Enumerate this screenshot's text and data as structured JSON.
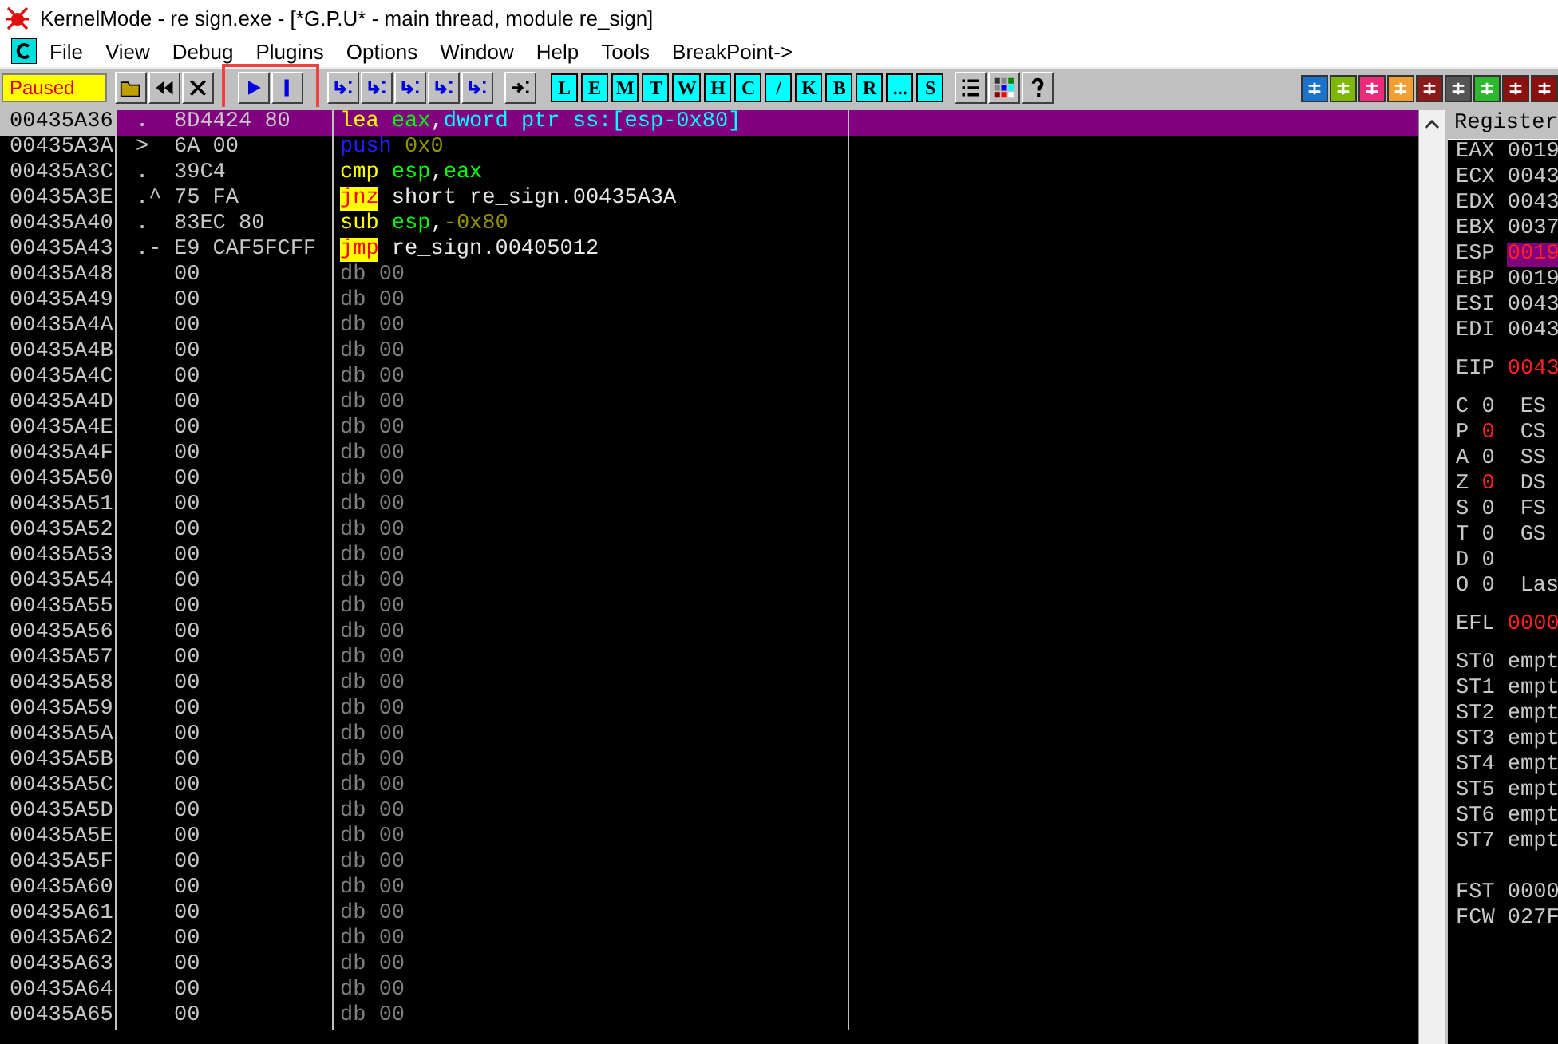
{
  "window": {
    "title": "KernelMode - re sign.exe - [*G.P.U* - main thread, module re_sign]"
  },
  "menu": [
    "File",
    "View",
    "Debug",
    "Plugins",
    "Options",
    "Window",
    "Help",
    "Tools",
    "BreakPoint->"
  ],
  "toolbar": {
    "status": "Paused",
    "run_pause_highlighted": true,
    "letter_buttons": [
      "L",
      "E",
      "M",
      "T",
      "W",
      "H",
      "C",
      "/",
      "K",
      "B",
      "R",
      "...",
      "S"
    ]
  },
  "disassembly": [
    {
      "address": "00435A36",
      "marker": ".",
      "bytes": "8D4424 80",
      "selected": true,
      "mnemonic": {
        "text": "lea",
        "kind": "normal"
      },
      "operands": [
        {
          "text": "eax",
          "kind": "reg"
        },
        {
          "text": ",",
          "kind": "plain"
        },
        {
          "text": "dword ptr ss:[esp-0x80]",
          "kind": "mem"
        }
      ]
    },
    {
      "address": "00435A3A",
      "marker": ">",
      "bytes": "6A 00",
      "selected": false,
      "mnemonic": {
        "text": "push",
        "kind": "stack"
      },
      "operands": [
        {
          "text": "0x0",
          "kind": "imm"
        }
      ]
    },
    {
      "address": "00435A3C",
      "marker": ".",
      "bytes": "39C4",
      "selected": false,
      "mnemonic": {
        "text": "cmp",
        "kind": "normal"
      },
      "operands": [
        {
          "text": "esp",
          "kind": "reg"
        },
        {
          "text": ",",
          "kind": "plain"
        },
        {
          "text": "eax",
          "kind": "reg"
        }
      ]
    },
    {
      "address": "00435A3E",
      "marker": ".^",
      "bytes": "75 FA",
      "selected": false,
      "mnemonic": {
        "text": "jnz",
        "kind": "jump"
      },
      "operands": [
        {
          "text": "short re_sign.00435A3A",
          "kind": "plain"
        }
      ]
    },
    {
      "address": "00435A40",
      "marker": ".",
      "bytes": "83EC 80",
      "selected": false,
      "mnemonic": {
        "text": "sub",
        "kind": "normal"
      },
      "operands": [
        {
          "text": "esp",
          "kind": "reg"
        },
        {
          "text": ",",
          "kind": "plain"
        },
        {
          "text": "-0x80",
          "kind": "imm"
        }
      ]
    },
    {
      "address": "00435A43",
      "marker": ".-",
      "bytes": "E9 CAF5FCFF",
      "selected": false,
      "mnemonic": {
        "text": "jmp",
        "kind": "jump"
      },
      "operands": [
        {
          "text": "re_sign.00405012",
          "kind": "plain"
        }
      ]
    },
    {
      "address": "00435A48",
      "bytes": "00",
      "selected": false,
      "mnemonic": {
        "text": "db",
        "kind": "data"
      },
      "operands": [
        {
          "text": "00",
          "kind": "data"
        }
      ]
    },
    {
      "address": "00435A49",
      "bytes": "00",
      "selected": false,
      "mnemonic": {
        "text": "db",
        "kind": "data"
      },
      "operands": [
        {
          "text": "00",
          "kind": "data"
        }
      ]
    },
    {
      "address": "00435A4A",
      "bytes": "00",
      "selected": false,
      "mnemonic": {
        "text": "db",
        "kind": "data"
      },
      "operands": [
        {
          "text": "00",
          "kind": "data"
        }
      ]
    },
    {
      "address": "00435A4B",
      "bytes": "00",
      "selected": false,
      "mnemonic": {
        "text": "db",
        "kind": "data"
      },
      "operands": [
        {
          "text": "00",
          "kind": "data"
        }
      ]
    },
    {
      "address": "00435A4C",
      "bytes": "00",
      "selected": false,
      "mnemonic": {
        "text": "db",
        "kind": "data"
      },
      "operands": [
        {
          "text": "00",
          "kind": "data"
        }
      ]
    },
    {
      "address": "00435A4D",
      "bytes": "00",
      "selected": false,
      "mnemonic": {
        "text": "db",
        "kind": "data"
      },
      "operands": [
        {
          "text": "00",
          "kind": "data"
        }
      ]
    },
    {
      "address": "00435A4E",
      "bytes": "00",
      "selected": false,
      "mnemonic": {
        "text": "db",
        "kind": "data"
      },
      "operands": [
        {
          "text": "00",
          "kind": "data"
        }
      ]
    },
    {
      "address": "00435A4F",
      "bytes": "00",
      "selected": false,
      "mnemonic": {
        "text": "db",
        "kind": "data"
      },
      "operands": [
        {
          "text": "00",
          "kind": "data"
        }
      ]
    },
    {
      "address": "00435A50",
      "bytes": "00",
      "selected": false,
      "mnemonic": {
        "text": "db",
        "kind": "data"
      },
      "operands": [
        {
          "text": "00",
          "kind": "data"
        }
      ]
    },
    {
      "address": "00435A51",
      "bytes": "00",
      "selected": false,
      "mnemonic": {
        "text": "db",
        "kind": "data"
      },
      "operands": [
        {
          "text": "00",
          "kind": "data"
        }
      ]
    },
    {
      "address": "00435A52",
      "bytes": "00",
      "selected": false,
      "mnemonic": {
        "text": "db",
        "kind": "data"
      },
      "operands": [
        {
          "text": "00",
          "kind": "data"
        }
      ]
    },
    {
      "address": "00435A53",
      "bytes": "00",
      "selected": false,
      "mnemonic": {
        "text": "db",
        "kind": "data"
      },
      "operands": [
        {
          "text": "00",
          "kind": "data"
        }
      ]
    },
    {
      "address": "00435A54",
      "bytes": "00",
      "selected": false,
      "mnemonic": {
        "text": "db",
        "kind": "data"
      },
      "operands": [
        {
          "text": "00",
          "kind": "data"
        }
      ]
    },
    {
      "address": "00435A55",
      "bytes": "00",
      "selected": false,
      "mnemonic": {
        "text": "db",
        "kind": "data"
      },
      "operands": [
        {
          "text": "00",
          "kind": "data"
        }
      ]
    },
    {
      "address": "00435A56",
      "bytes": "00",
      "selected": false,
      "mnemonic": {
        "text": "db",
        "kind": "data"
      },
      "operands": [
        {
          "text": "00",
          "kind": "data"
        }
      ]
    },
    {
      "address": "00435A57",
      "bytes": "00",
      "selected": false,
      "mnemonic": {
        "text": "db",
        "kind": "data"
      },
      "operands": [
        {
          "text": "00",
          "kind": "data"
        }
      ]
    },
    {
      "address": "00435A58",
      "bytes": "00",
      "selected": false,
      "mnemonic": {
        "text": "db",
        "kind": "data"
      },
      "operands": [
        {
          "text": "00",
          "kind": "data"
        }
      ]
    },
    {
      "address": "00435A59",
      "bytes": "00",
      "selected": false,
      "mnemonic": {
        "text": "db",
        "kind": "data"
      },
      "operands": [
        {
          "text": "00",
          "kind": "data"
        }
      ]
    },
    {
      "address": "00435A5A",
      "bytes": "00",
      "selected": false,
      "mnemonic": {
        "text": "db",
        "kind": "data"
      },
      "operands": [
        {
          "text": "00",
          "kind": "data"
        }
      ]
    },
    {
      "address": "00435A5B",
      "bytes": "00",
      "selected": false,
      "mnemonic": {
        "text": "db",
        "kind": "data"
      },
      "operands": [
        {
          "text": "00",
          "kind": "data"
        }
      ]
    },
    {
      "address": "00435A5C",
      "bytes": "00",
      "selected": false,
      "mnemonic": {
        "text": "db",
        "kind": "data"
      },
      "operands": [
        {
          "text": "00",
          "kind": "data"
        }
      ]
    },
    {
      "address": "00435A5D",
      "bytes": "00",
      "selected": false,
      "mnemonic": {
        "text": "db",
        "kind": "data"
      },
      "operands": [
        {
          "text": "00",
          "kind": "data"
        }
      ]
    },
    {
      "address": "00435A5E",
      "bytes": "00",
      "selected": false,
      "mnemonic": {
        "text": "db",
        "kind": "data"
      },
      "operands": [
        {
          "text": "00",
          "kind": "data"
        }
      ]
    },
    {
      "address": "00435A5F",
      "bytes": "00",
      "selected": false,
      "mnemonic": {
        "text": "db",
        "kind": "data"
      },
      "operands": [
        {
          "text": "00",
          "kind": "data"
        }
      ]
    },
    {
      "address": "00435A60",
      "bytes": "00",
      "selected": false,
      "mnemonic": {
        "text": "db",
        "kind": "data"
      },
      "operands": [
        {
          "text": "00",
          "kind": "data"
        }
      ]
    },
    {
      "address": "00435A61",
      "bytes": "00",
      "selected": false,
      "mnemonic": {
        "text": "db",
        "kind": "data"
      },
      "operands": [
        {
          "text": "00",
          "kind": "data"
        }
      ]
    },
    {
      "address": "00435A62",
      "bytes": "00",
      "selected": false,
      "mnemonic": {
        "text": "db",
        "kind": "data"
      },
      "operands": [
        {
          "text": "00",
          "kind": "data"
        }
      ]
    },
    {
      "address": "00435A63",
      "bytes": "00",
      "selected": false,
      "mnemonic": {
        "text": "db",
        "kind": "data"
      },
      "operands": [
        {
          "text": "00",
          "kind": "data"
        }
      ]
    },
    {
      "address": "00435A64",
      "bytes": "00",
      "selected": false,
      "mnemonic": {
        "text": "db",
        "kind": "data"
      },
      "operands": [
        {
          "text": "00",
          "kind": "data"
        }
      ]
    },
    {
      "address": "00435A65",
      "bytes": "00",
      "selected": false,
      "mnemonic": {
        "text": "db",
        "kind": "data"
      },
      "operands": [
        {
          "text": "00",
          "kind": "data"
        }
      ]
    }
  ],
  "registers": {
    "title": "Register",
    "general": [
      {
        "name": "EAX",
        "value": "0019",
        "changed": false,
        "selected": false
      },
      {
        "name": "ECX",
        "value": "0043",
        "changed": false,
        "selected": false
      },
      {
        "name": "EDX",
        "value": "0043",
        "changed": false,
        "selected": false
      },
      {
        "name": "EBX",
        "value": "0037",
        "changed": false,
        "selected": false
      },
      {
        "name": "ESP",
        "value": "0019",
        "changed": true,
        "selected": true
      },
      {
        "name": "EBP",
        "value": "0019",
        "changed": false,
        "selected": false
      },
      {
        "name": "ESI",
        "value": "0043",
        "changed": false,
        "selected": false
      },
      {
        "name": "EDI",
        "value": "0043",
        "changed": false,
        "selected": false
      }
    ],
    "eip": {
      "name": "EIP",
      "value": "0043",
      "changed": true
    },
    "flags": [
      {
        "name": "C",
        "value": "0",
        "changed": false,
        "segment": "ES"
      },
      {
        "name": "P",
        "value": "0",
        "changed": true,
        "segment": "CS"
      },
      {
        "name": "A",
        "value": "0",
        "changed": false,
        "segment": "SS"
      },
      {
        "name": "Z",
        "value": "0",
        "changed": true,
        "segment": "DS"
      },
      {
        "name": "S",
        "value": "0",
        "changed": false,
        "segment": "FS"
      },
      {
        "name": "T",
        "value": "0",
        "changed": false,
        "segment": "GS"
      },
      {
        "name": "D",
        "value": "0",
        "changed": false
      },
      {
        "name": "O",
        "value": "0",
        "changed": false,
        "segment": "Las"
      }
    ],
    "efl": {
      "name": "EFL",
      "value": "0000",
      "changed": true
    },
    "fpu": [
      {
        "name": "ST0",
        "value": "empt"
      },
      {
        "name": "ST1",
        "value": "empt"
      },
      {
        "name": "ST2",
        "value": "empt"
      },
      {
        "name": "ST3",
        "value": "empt"
      },
      {
        "name": "ST4",
        "value": "empt"
      },
      {
        "name": "ST5",
        "value": "empt"
      },
      {
        "name": "ST6",
        "value": "empt"
      },
      {
        "name": "ST7",
        "value": "empt"
      }
    ],
    "fpu_status": [
      {
        "name": "FST",
        "value": "0000"
      },
      {
        "name": "FCW",
        "value": "027F"
      }
    ]
  }
}
